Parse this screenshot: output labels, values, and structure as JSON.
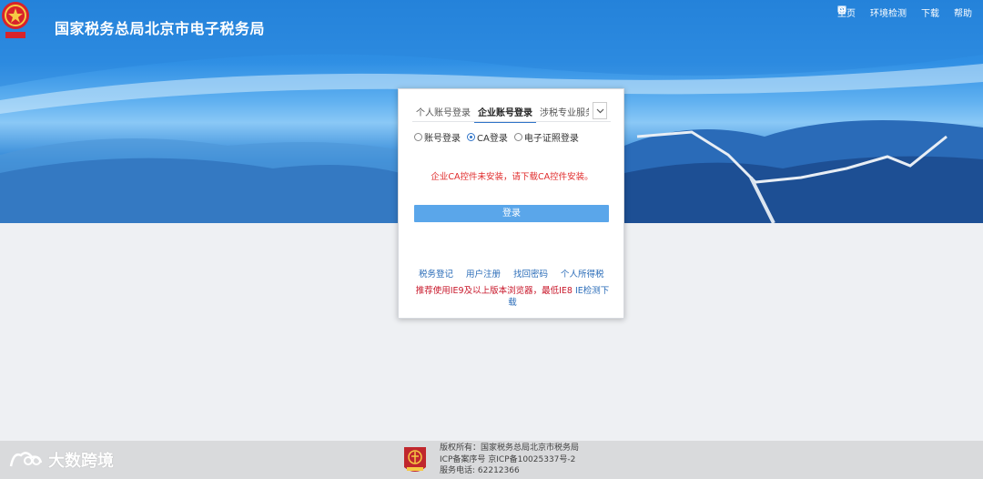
{
  "header": {
    "title": "国家税务总局北京市电子税务局",
    "nav": [
      {
        "icon": "home-icon",
        "label": "主页"
      },
      {
        "icon": "monitor-icon",
        "label": "环境检测"
      },
      {
        "icon": "download-icon",
        "label": "下载"
      },
      {
        "icon": "help-icon",
        "label": "帮助"
      }
    ]
  },
  "login": {
    "tabs": [
      "个人账号登录",
      "企业账号登录",
      "涉税专业服务"
    ],
    "active_tab": 1,
    "modes": [
      "账号登录",
      "CA登录",
      "电子证照登录"
    ],
    "selected_mode": 1,
    "warning": "企业CA控件未安装，请下载CA控件安装。",
    "login_button": "登录",
    "links": [
      "税务登记",
      "用户注册",
      "找回密码",
      "个人所得税"
    ],
    "recommend_text": "推荐使用IE9及以上版本浏览器，最低IE8",
    "ie_link": "IE检测下载"
  },
  "footer": {
    "brand": "大数跨境",
    "copyright": "版权所有：国家税务总局北京市税务局",
    "icp": "ICP备案序号 京ICP备10025337号-2",
    "phone": "服务电话: 62212366"
  },
  "colors": {
    "accent": "#2f74c8",
    "button": "#5aa6ea",
    "warning": "#e02b2b"
  }
}
